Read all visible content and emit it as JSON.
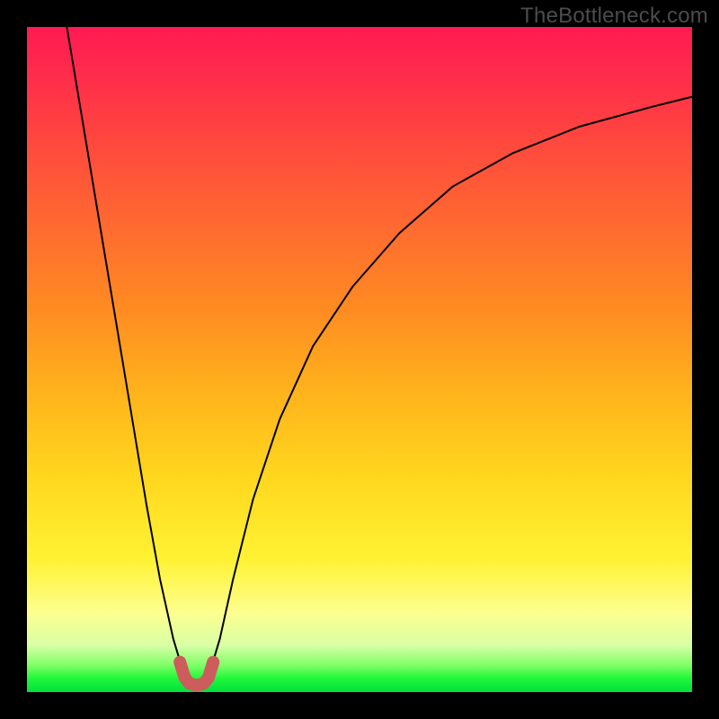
{
  "watermark": {
    "text": "TheBottleneck.com"
  },
  "chart_data": {
    "type": "line",
    "title": "",
    "xlabel": "",
    "ylabel": "",
    "xlim": [
      0,
      100
    ],
    "ylim": [
      0,
      100
    ],
    "grid": false,
    "legend": false,
    "annotations": [],
    "series": [
      {
        "name": "left-branch",
        "x": [
          6,
          8,
          10,
          12,
          14,
          16,
          18,
          20,
          22,
          23.5
        ],
        "y": [
          100,
          88,
          76,
          64,
          52,
          40,
          28,
          17,
          8,
          3
        ],
        "stroke": "#000000",
        "width": 2
      },
      {
        "name": "right-branch",
        "x": [
          27.5,
          29,
          31,
          34,
          38,
          43,
          49,
          56,
          64,
          73,
          83,
          94,
          100
        ],
        "y": [
          3,
          8,
          17,
          29,
          41,
          52,
          61,
          69,
          76,
          81,
          85,
          88,
          89.5
        ],
        "stroke": "#000000",
        "width": 2
      },
      {
        "name": "u-marker",
        "x": [
          23,
          23.7,
          24.4,
          25.5,
          26.6,
          27.3,
          28
        ],
        "y": [
          4.5,
          2.2,
          1.3,
          1.0,
          1.3,
          2.2,
          4.5
        ],
        "stroke": "#cd5c5c",
        "width": 14
      }
    ]
  }
}
